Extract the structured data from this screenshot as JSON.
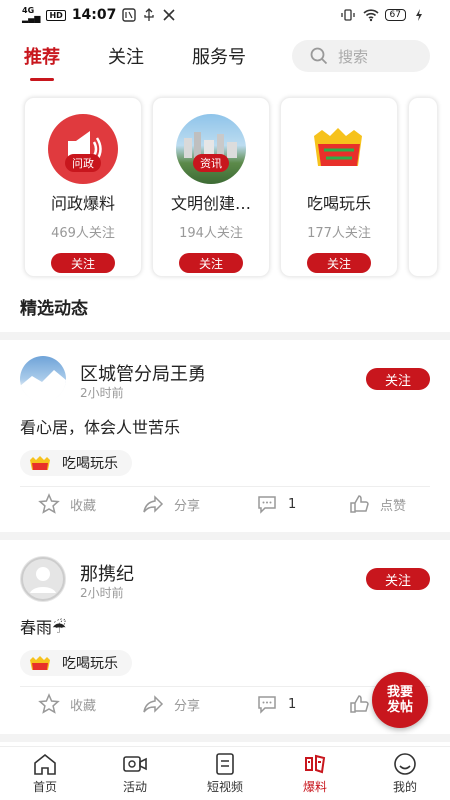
{
  "status_bar": {
    "network": "4G",
    "hd": "HD",
    "time": "14:07",
    "battery": "67"
  },
  "tabs": [
    {
      "label": "推荐",
      "active": true
    },
    {
      "label": "关注",
      "active": false
    },
    {
      "label": "服务号",
      "active": false
    }
  ],
  "search": {
    "placeholder": "搜索"
  },
  "cards": [
    {
      "tag": "问政",
      "name": "问政爆料",
      "count": "469人关注",
      "follow": "关注"
    },
    {
      "tag": "资讯",
      "name": "文明创建…",
      "count": "194人关注",
      "follow": "关注"
    },
    {
      "name": "吃喝玩乐",
      "count": "177人关注",
      "follow": "关注"
    }
  ],
  "section_title": "精选动态",
  "posts": [
    {
      "author": "区城管分局王勇",
      "time": "2小时前",
      "follow": "关注",
      "content": "看心居，体会人世苦乐",
      "topic": "吃喝玩乐",
      "actions": {
        "collect": "收藏",
        "share": "分享",
        "comments": "1",
        "like": "点赞"
      }
    },
    {
      "author": "那携纪",
      "time": "2小时前",
      "follow": "关注",
      "content": "春雨☔",
      "topic": "吃喝玩乐",
      "actions": {
        "collect": "收藏",
        "share": "分享",
        "comments": "1"
      }
    }
  ],
  "fab": {
    "line1": "我要",
    "line2": "发帖"
  },
  "bottom_nav": [
    {
      "label": "首页",
      "icon": "home-icon"
    },
    {
      "label": "活动",
      "icon": "video-camera-icon"
    },
    {
      "label": "短视频",
      "icon": "short-video-icon"
    },
    {
      "label": "爆料",
      "icon": "wenzheng-logo-icon",
      "active": true
    },
    {
      "label": "我的",
      "icon": "smiley-icon"
    }
  ],
  "colors": {
    "accent": "#c8161d",
    "muted": "#999999",
    "divider": "#f3f3f3"
  }
}
